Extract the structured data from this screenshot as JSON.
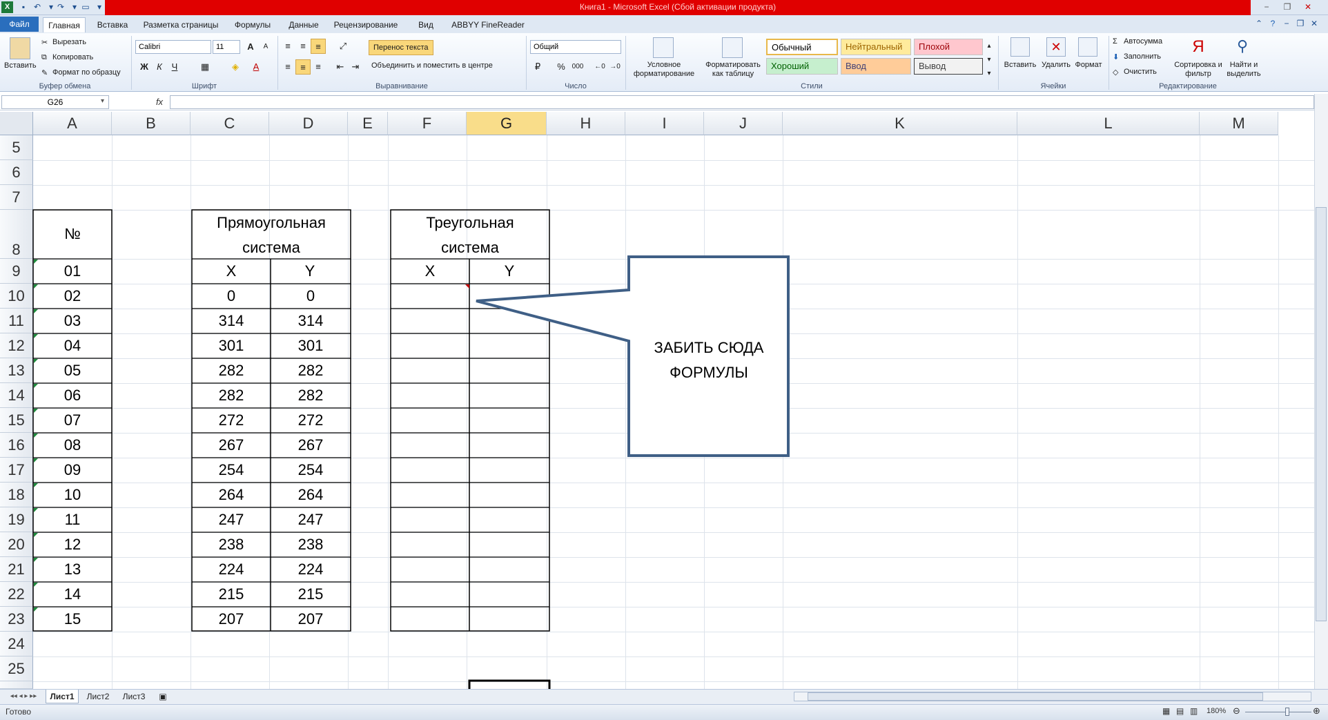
{
  "window": {
    "title": "Книга1 - Microsoft Excel (Сбой активации продукта)",
    "app_icon": "X",
    "controls": [
      "−",
      "❐",
      "✕"
    ]
  },
  "tabs": [
    "Файл",
    "Главная",
    "Вставка",
    "Разметка страницы",
    "Формулы",
    "Данные",
    "Рецензирование",
    "Вид",
    "ABBYY FineReader 11"
  ],
  "ribbon": {
    "clipboard": {
      "paste": "Вставить",
      "cut": "Вырезать",
      "copy": "Копировать",
      "format_painter": "Формат по образцу",
      "label": "Буфер обмена"
    },
    "font": {
      "name": "Calibri",
      "size": "11",
      "bold": "Ж",
      "italic": "К",
      "underline": "Ч",
      "grow": "A",
      "shrink": "A",
      "label": "Шрифт"
    },
    "alignment": {
      "wrap": "Перенос текста",
      "merge": "Объединить и поместить в центре",
      "label": "Выравнивание"
    },
    "number": {
      "format": "Общий",
      "percent": "%",
      "thousands": "000",
      "label": "Число"
    },
    "styles": {
      "conditional": "Условное форматирование",
      "as_table": "Форматировать как таблицу",
      "normal": "Обычный",
      "neutral": "Нейтральный",
      "bad": "Плохой",
      "good": "Хороший",
      "input": "Ввод",
      "output": "Вывод",
      "label": "Стили"
    },
    "cells": {
      "insert": "Вставить",
      "delete": "Удалить",
      "format": "Формат",
      "label": "Ячейки"
    },
    "editing": {
      "autosum": "Автосумма",
      "fill": "Заполнить",
      "clear": "Очистить",
      "sort": "Сортировка и фильтр",
      "find": "Найти и выделить",
      "label": "Редактирование"
    }
  },
  "formula_bar": {
    "name_box": "G26",
    "fx": "fx",
    "value": ""
  },
  "grid": {
    "columns": [
      "A",
      "B",
      "C",
      "D",
      "E",
      "F",
      "G",
      "H",
      "I",
      "J",
      "K",
      "L",
      "M"
    ],
    "selected_column": "G",
    "rows": [
      "5",
      "6",
      "7",
      "8",
      "9",
      "10",
      "11",
      "12",
      "13",
      "14",
      "15",
      "16",
      "17",
      "18",
      "19",
      "20",
      "21",
      "22",
      "23",
      "24",
      "25"
    ],
    "header_no": "№",
    "rect_title_1": "Прямоугольная",
    "rect_title_2": "система",
    "tri_title_1": "Треугольная",
    "tri_title_2": "система",
    "x_label": "X",
    "y_label": "Y",
    "numbers": [
      "01",
      "02",
      "03",
      "04",
      "05",
      "06",
      "07",
      "08",
      "09",
      "10",
      "11",
      "12",
      "13",
      "14",
      "15"
    ],
    "rect_x": [
      "0",
      "314",
      "301",
      "282",
      "282",
      "272",
      "267",
      "254",
      "264",
      "247",
      "238",
      "224",
      "215",
      "207"
    ],
    "rect_y": [
      "0",
      "314",
      "301",
      "282",
      "282",
      "272",
      "267",
      "254",
      "264",
      "247",
      "238",
      "224",
      "215",
      "207"
    ]
  },
  "callout": {
    "line1": "ЗАБИТЬ СЮДА",
    "line2": "ФОРМУЛЫ"
  },
  "sheets": [
    "Лист1",
    "Лист2",
    "Лист3"
  ],
  "status": {
    "ready": "Готово",
    "zoom": "180%"
  }
}
